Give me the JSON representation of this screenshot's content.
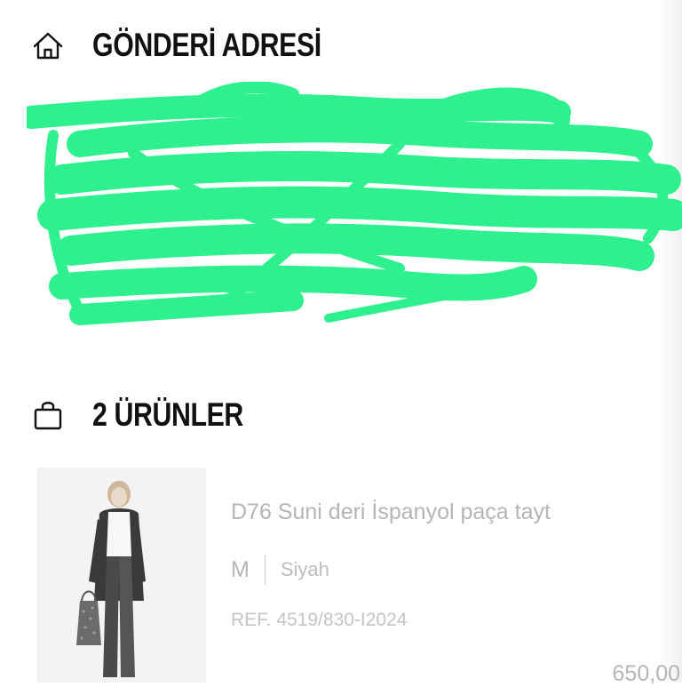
{
  "shipping": {
    "title": "GÖNDERİ ADRESİ",
    "icon": "home-icon",
    "address_lines": [
      "",
      "",
      "",
      "",
      ""
    ]
  },
  "products": {
    "title": "2 ÜRÜNLER",
    "icon": "shopping-bag-icon",
    "items": [
      {
        "name": "D76 Suni deri İspanyol paça tayt",
        "size": "M",
        "color": "Siyah",
        "ref": "REF. 4519/830-I2024",
        "price": "650,00"
      }
    ]
  },
  "colors": {
    "redaction": "#2ef08f",
    "muted_text": "#b5b5b5"
  }
}
